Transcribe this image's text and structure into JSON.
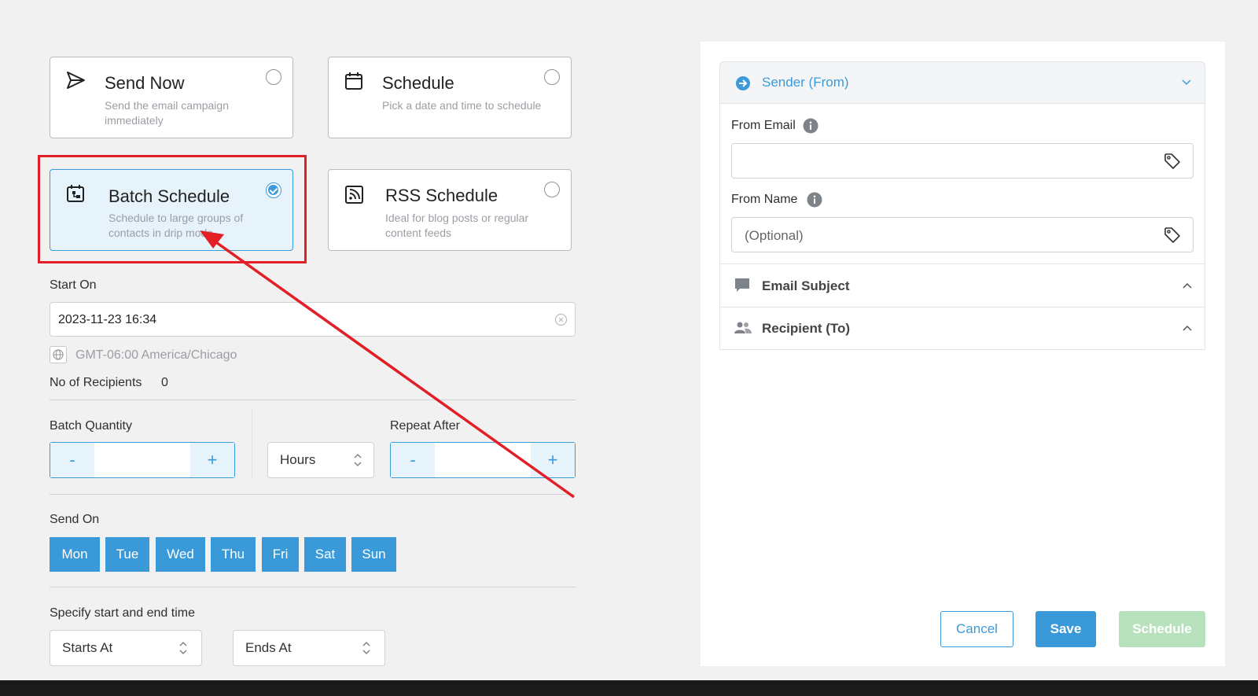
{
  "options": [
    {
      "title": "Send Now",
      "desc": "Send the email campaign immediately",
      "icon": "send-icon"
    },
    {
      "title": "Schedule",
      "desc": "Pick a date and time to schedule",
      "icon": "calendar-icon"
    },
    {
      "title": "Batch Schedule",
      "desc": "Schedule to large groups of contacts in drip mode",
      "icon": "batch-calendar-icon",
      "selected": true
    },
    {
      "title": "RSS Schedule",
      "desc": "Ideal for blog posts or regular content feeds",
      "icon": "rss-icon"
    }
  ],
  "start_on": {
    "label": "Start On",
    "value": "2023-11-23 16:34",
    "timezone": "GMT-06:00 America/Chicago"
  },
  "recipients": {
    "label": "No of Recipients",
    "count": "0"
  },
  "batch": {
    "quantity_label": "Batch Quantity",
    "unit": "Hours",
    "repeat_label": "Repeat After",
    "minus": "-",
    "plus": "+"
  },
  "send_on": {
    "label": "Send On",
    "days": [
      "Mon",
      "Tue",
      "Wed",
      "Thu",
      "Fri",
      "Sat",
      "Sun"
    ]
  },
  "time_range": {
    "label": "Specify start and end time",
    "starts": "Starts At",
    "ends": "Ends At"
  },
  "right": {
    "sender": {
      "title": "Sender (From)",
      "from_email_label": "From Email",
      "from_name_label": "From Name",
      "from_name_placeholder": "(Optional)"
    },
    "subject": {
      "title": "Email Subject"
    },
    "recipient": {
      "title": "Recipient (To)"
    }
  },
  "footer": {
    "cancel": "Cancel",
    "save": "Save",
    "schedule": "Schedule"
  },
  "colors": {
    "accent": "#3b9ad9",
    "highlight": "#e53935",
    "disabled": "#a8d8b0"
  }
}
